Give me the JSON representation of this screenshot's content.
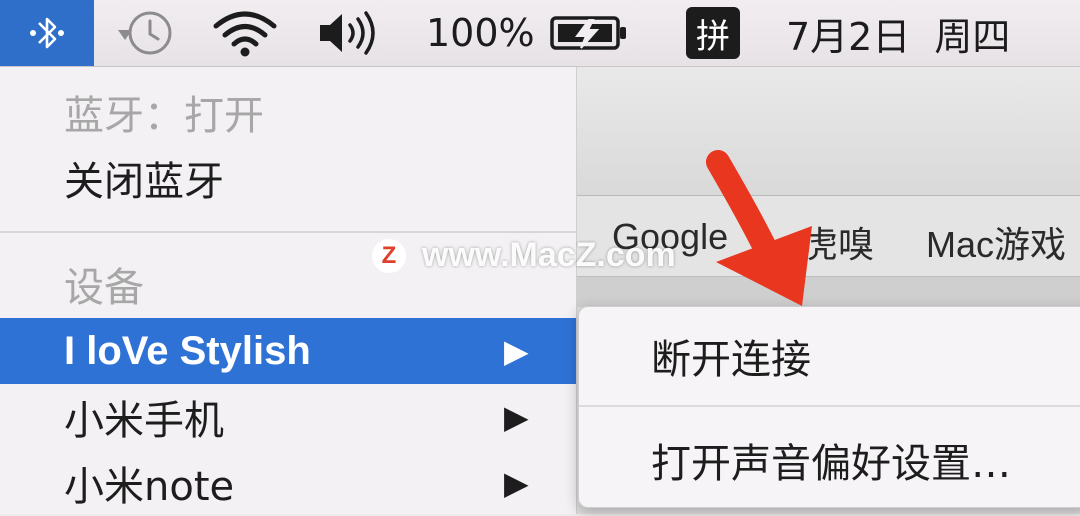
{
  "menubar": {
    "battery_percent": "100%",
    "ime_label": "拼",
    "date": "7月2日",
    "weekday": "周四",
    "icons": [
      "bluetooth-icon",
      "time-machine-icon",
      "wifi-icon",
      "volume-icon",
      "battery-charging-icon"
    ]
  },
  "bluetooth_menu": {
    "status": "蓝牙：打开",
    "toggle": "关闭蓝牙",
    "devices_header": "设备",
    "devices": [
      {
        "label": "I loVe Stylish",
        "selected": true
      },
      {
        "label": "小米手机",
        "selected": false
      },
      {
        "label": "小米note",
        "selected": false
      }
    ]
  },
  "submenu": {
    "items": [
      "断开连接",
      "打开声音偏好设置…"
    ]
  },
  "browser": {
    "bookmarks": [
      "Google",
      "虎嗅",
      "Mac游戏"
    ]
  },
  "watermark": {
    "logo": "Z",
    "text": "www.MacZ.com"
  },
  "colors": {
    "accent": "#2f72d6",
    "annotation": "#e8361f"
  }
}
